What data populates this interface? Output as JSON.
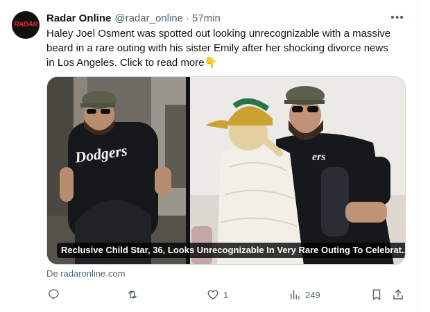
{
  "account": {
    "avatar_text": "RADAR",
    "name": "Radar Online",
    "handle": "@radar_online",
    "separator": "·",
    "time": "57min"
  },
  "tweet": {
    "text_line1": "Haley Joel Osment was spotted out looking unrecognizable with a massive",
    "text_line2": "beard in a rare outing with his sister Emily after her shocking divorce news",
    "text_line3": "in Los Angeles. Click to read more",
    "emoji": "👇"
  },
  "card": {
    "shirt_text": "Dodgers",
    "caption": "Reclusive Child Star, 36, Looks Unrecognizable In Very Rare Outing To Celebrat...",
    "source": "De radaronline.com"
  },
  "actions": {
    "reply_count": "",
    "retweet_count": "",
    "like_count": "1",
    "views_count": "249"
  },
  "colors": {
    "text": "#0f1419",
    "secondary": "#536471",
    "border": "#cfd9de",
    "brand_red": "#e0262b"
  }
}
